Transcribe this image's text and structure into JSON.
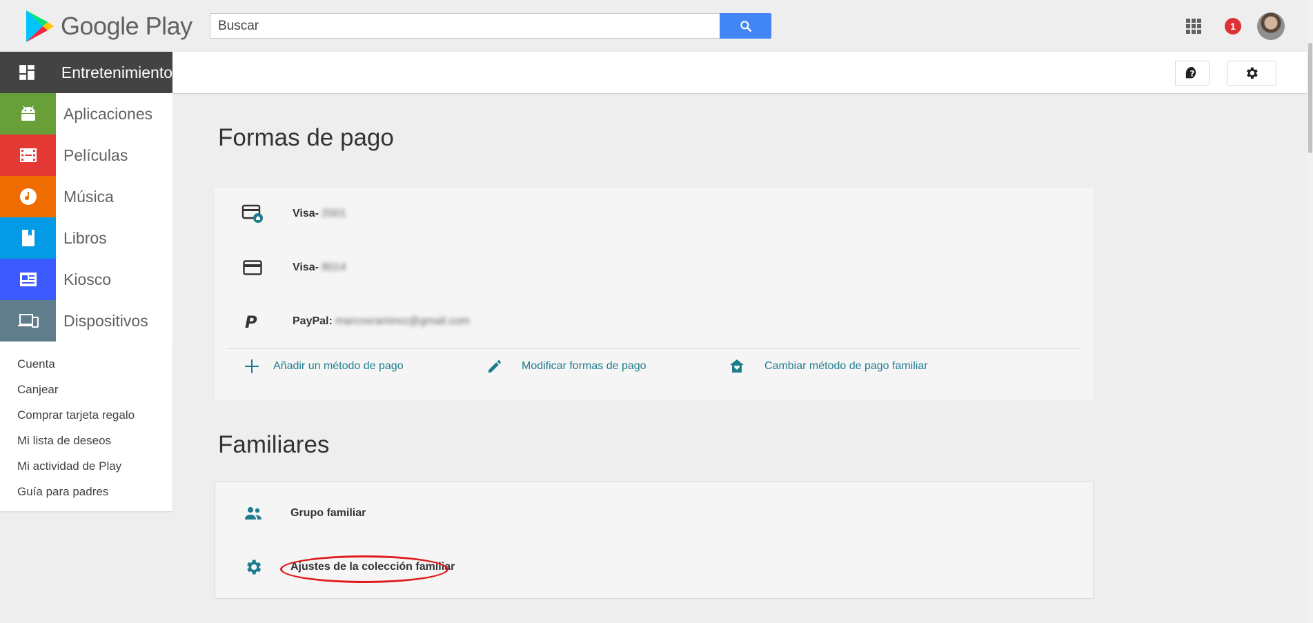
{
  "topbar": {
    "logo_text": "Google Play",
    "search_placeholder": "Buscar",
    "notification_count": "1"
  },
  "sidebar": {
    "categories": [
      {
        "label": "Entretenimiento",
        "color": "#434343",
        "icon": "dashboard-icon"
      },
      {
        "label": "Aplicaciones",
        "color": "#689f38",
        "icon": "android-icon"
      },
      {
        "label": "Películas",
        "color": "#e53935",
        "icon": "film-icon"
      },
      {
        "label": "Música",
        "color": "#ef6c00",
        "icon": "music-icon"
      },
      {
        "label": "Libros",
        "color": "#039be5",
        "icon": "book-icon"
      },
      {
        "label": "Kiosco",
        "color": "#3d5afe",
        "icon": "newspaper-icon"
      },
      {
        "label": "Dispositivos",
        "color": "#607d8b",
        "icon": "devices-icon"
      }
    ],
    "links": [
      "Cuenta",
      "Canjear",
      "Comprar tarjeta regalo",
      "Mi lista de deseos",
      "Mi actividad de Play",
      "Guía para padres"
    ]
  },
  "payment": {
    "title": "Formas de pago",
    "methods": [
      {
        "label": "Visa-",
        "masked": "2001",
        "icon": "family-card-icon"
      },
      {
        "label": "Visa-",
        "masked": "8014",
        "icon": "credit-card-icon"
      },
      {
        "label": "PayPal:",
        "masked": "marcosramirez@gmail.com",
        "icon": "paypal-icon"
      }
    ],
    "actions": {
      "add": "Añadir un método de pago",
      "edit": "Modificar formas de pago",
      "family": "Cambiar método de pago familiar"
    }
  },
  "family": {
    "title": "Familiares",
    "items": [
      {
        "label": "Grupo familiar",
        "icon": "people-icon"
      },
      {
        "label": "Ajustes de la colección familiar",
        "icon": "gear-icon"
      }
    ]
  },
  "colors": {
    "accent_teal": "#1d7c8e",
    "search_button": "#4285f4",
    "badge_red": "#db3236",
    "highlight_red": "#e11b1b"
  }
}
